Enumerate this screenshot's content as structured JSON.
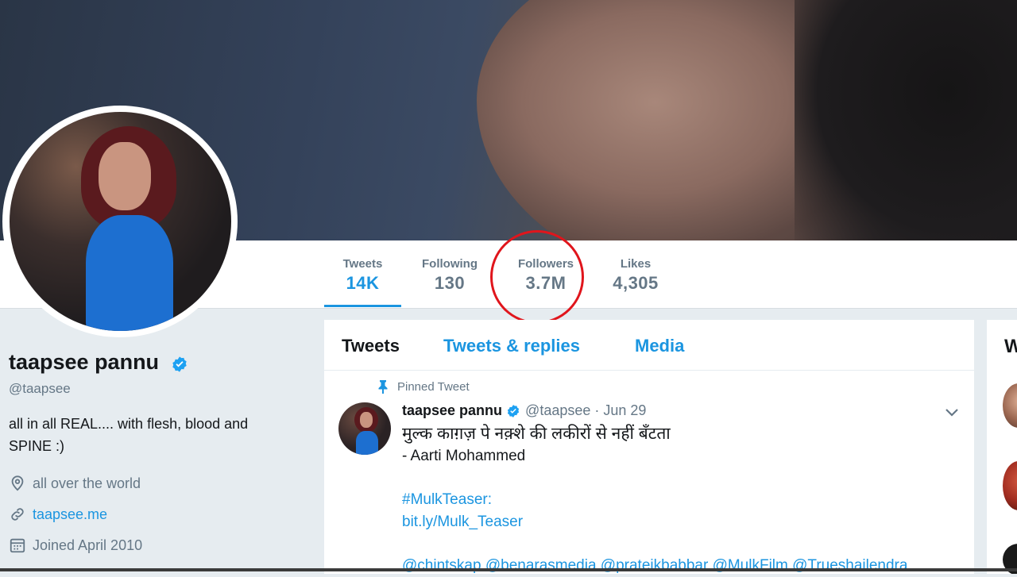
{
  "stats": [
    {
      "label": "Tweets",
      "value": "14K"
    },
    {
      "label": "Following",
      "value": "130"
    },
    {
      "label": "Followers",
      "value": "3.7M"
    },
    {
      "label": "Likes",
      "value": "4,305"
    }
  ],
  "profile": {
    "name": "taapsee pannu",
    "handle": "@taapsee",
    "bio": "all in all REAL.... with flesh, blood and SPINE :)",
    "location": "all over the world",
    "website": "taapsee.me",
    "joined": "Joined April 2010"
  },
  "tabs": [
    "Tweets",
    "Tweets & replies",
    "Media"
  ],
  "pinned_tweet": {
    "pin_label": "Pinned Tweet",
    "author_name": "taapsee pannu",
    "author_handle": "@taapsee",
    "separator": "·",
    "date": "Jun 29",
    "line1": "मुल्क काग़ज़ पे नक़्शे की लकीरों से नहीं बँटता",
    "line2": "- Aarti Mohammed",
    "hashtag": "#MulkTeaser",
    "hashtag_suffix": ":",
    "link": "bit.ly/Mulk_Teaser",
    "mentions": "@chintskap @benarasmedia @prateikbabbar @MulkFilm @Trueshailendra"
  },
  "right_panel": {
    "title_partial": "W"
  },
  "colors": {
    "accent": "#1b95e0",
    "annotation_circle": "#e0151c",
    "text_primary": "#14171a",
    "text_secondary": "#657786"
  }
}
